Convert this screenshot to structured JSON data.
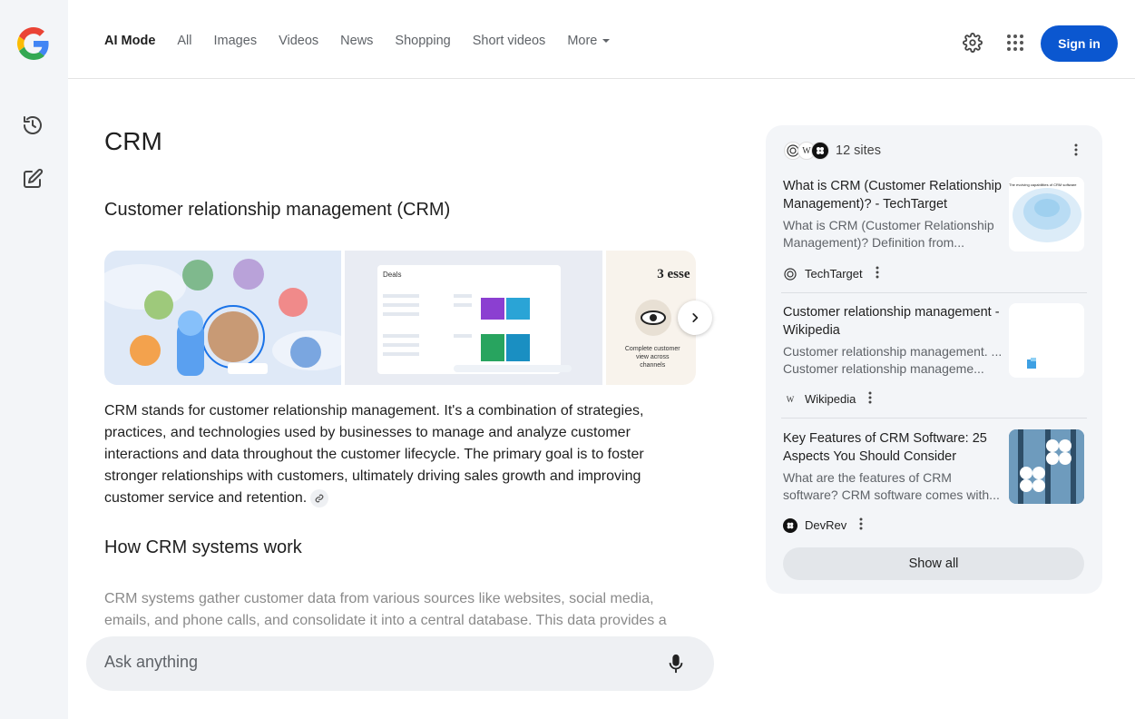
{
  "header": {
    "tabs": [
      {
        "label": "AI Mode",
        "active": true
      },
      {
        "label": "All"
      },
      {
        "label": "Images"
      },
      {
        "label": "Videos"
      },
      {
        "label": "News"
      },
      {
        "label": "Shopping"
      },
      {
        "label": "Short videos"
      },
      {
        "label": "More"
      }
    ],
    "sign_in_label": "Sign in"
  },
  "main": {
    "query_title": "CRM",
    "section1_heading": "Customer relationship management (CRM)",
    "gallery": {
      "image2_heading": "Deals",
      "image3_heading": "3 esse",
      "image3_caption": "Complete customer view across channels"
    },
    "paragraph1": "CRM stands for customer relationship management. It's a combination of strategies, practices, and technologies used by businesses to manage and analyze customer interactions and data throughout the customer lifecycle. The primary goal is to foster stronger relationships with customers, ultimately driving sales growth and improving customer service and retention.",
    "section2_heading": "How CRM systems work",
    "paragraph2": "CRM systems gather customer data from various sources like websites, social media, emails, and phone calls, and consolidate it into a central database. This data provides a"
  },
  "askbar": {
    "placeholder": "Ask anything"
  },
  "sources": {
    "count_label": "12 sites",
    "items": [
      {
        "title": "What is CRM (Customer Relationship Management)? - TechTarget",
        "snippet": "What is CRM (Customer Relationship Management)? Definition from...",
        "site": "TechTarget",
        "thumb_text": "The evolving capabilities of CRM software"
      },
      {
        "title": "Customer relationship management - Wikipedia",
        "snippet": "Customer relationship management. ... Customer relationship manageme...",
        "site": "Wikipedia"
      },
      {
        "title": "Key Features of CRM Software: 25 Aspects You Should Consider",
        "snippet": "What are the features of CRM software? CRM software comes with...",
        "site": "DevRev"
      }
    ],
    "show_all_label": "Show all"
  },
  "colors": {
    "accent": "#0b57d0",
    "rail_bg": "#f3f5f8",
    "panel_bg": "#f3f5f8"
  }
}
